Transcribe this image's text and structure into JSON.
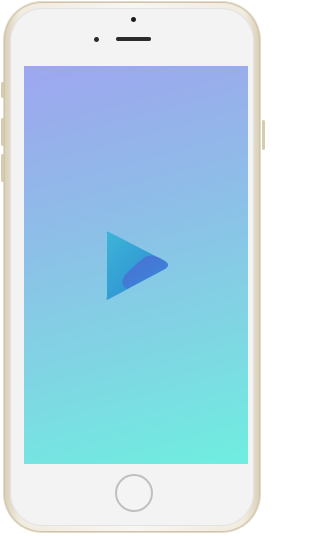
{
  "device": {
    "frame_color": "#f1ebdf",
    "screen_gradient": [
      "#9ea6ef",
      "#8fbbe8",
      "#7fd6e3",
      "#6feee0"
    ]
  },
  "screen": {
    "icon": "play-logo-icon",
    "logo_colors": [
      "#3aa1d6",
      "#2c7fcf",
      "#4d5fd0"
    ]
  }
}
